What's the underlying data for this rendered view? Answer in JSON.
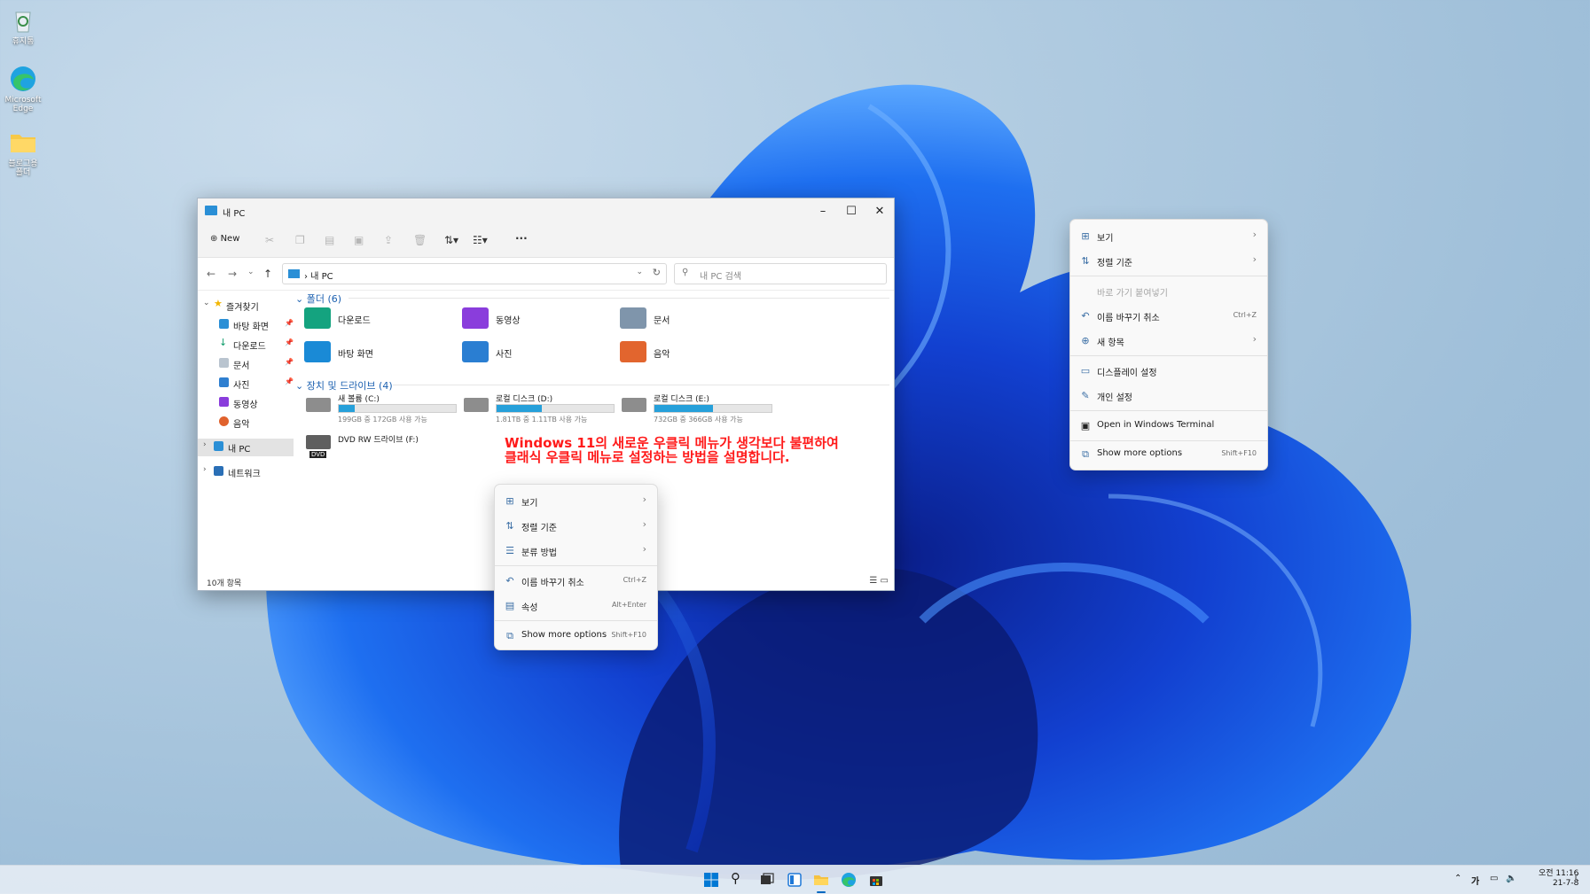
{
  "desktop": {
    "icons": [
      {
        "label": "휴지통",
        "icon": "recycle-bin-icon"
      },
      {
        "label": "Microsoft Edge",
        "icon": "edge-icon"
      },
      {
        "label": "블로그용 폴더",
        "icon": "folder-icon"
      }
    ]
  },
  "explorer": {
    "title": "내 PC",
    "toolbar": {
      "new_label": "New"
    },
    "address": "내 PC",
    "search_placeholder": "내 PC 검색",
    "sidebar": {
      "favorites": "즐겨찾기",
      "items": [
        "바탕 화면",
        "다운로드",
        "문서",
        "사진",
        "동영상",
        "음악"
      ],
      "this_pc": "내 PC",
      "network": "네트워크"
    },
    "folders_header": "폴더 (6)",
    "folders": [
      "다운로드",
      "동영상",
      "문서",
      "바탕 화면",
      "사진",
      "음악"
    ],
    "drives_header": "장치 및 드라이브 (4)",
    "drives": [
      {
        "name": "새 볼륨 (C:)",
        "stats": "199GB 중 172GB 사용 가능",
        "used_fraction": 0.14
      },
      {
        "name": "로컬 디스크 (D:)",
        "stats": "1.81TB 중 1.11TB 사용 가능",
        "used_fraction": 0.39
      },
      {
        "name": "로컬 디스크 (E:)",
        "stats": "732GB 중 366GB 사용 가능",
        "used_fraction": 0.5
      }
    ],
    "dvd": {
      "name": "DVD RW 드라이브 (F:)",
      "badge": "DVD"
    },
    "status": "10개 항목"
  },
  "overlay": {
    "line1": "Windows 11의 새로운 우클릭 메뉴가 생각보다 불편하여",
    "line2": "클래식 우클릭 메뉴로 설정하는 방법을 설명합니다."
  },
  "menu_file": {
    "items": [
      {
        "label": "보기",
        "icon": "grid-icon",
        "arrow": "›"
      },
      {
        "label": "정렬 기준",
        "icon": "sort-icon",
        "arrow": "›"
      },
      {
        "label": "분류 방법",
        "icon": "list-icon",
        "arrow": "›"
      },
      {
        "label": "이름 바꾸기 취소",
        "icon": "undo-icon",
        "shortcut": "Ctrl+Z"
      },
      {
        "label": "속성",
        "icon": "properties-icon",
        "shortcut": "Alt+Enter"
      },
      {
        "label": "Show more options",
        "icon": "more-options-icon",
        "shortcut": "Shift+F10"
      }
    ]
  },
  "menu_desktop": {
    "items": [
      {
        "label": "보기",
        "icon": "grid-icon",
        "arrow": "›"
      },
      {
        "label": "정렬 기준",
        "icon": "sort-icon",
        "arrow": "›"
      },
      {
        "label": "바로 가기 붙여넣기",
        "icon": "",
        "disabled": true
      },
      {
        "label": "이름 바꾸기 취소",
        "icon": "undo-icon",
        "shortcut": "Ctrl+Z"
      },
      {
        "label": "새 항목",
        "icon": "new-item-icon",
        "arrow": "›"
      },
      {
        "label": "디스플레이 설정",
        "icon": "display-icon"
      },
      {
        "label": "개인 설정",
        "icon": "pen-icon"
      },
      {
        "label": "Open in Windows Terminal",
        "icon": "terminal-icon"
      },
      {
        "label": "Show more options",
        "icon": "more-options-icon",
        "shortcut": "Shift+F10"
      }
    ]
  },
  "taskbar": {
    "ime": "가",
    "clock_time": "오전 11:16",
    "clock_date": "21-7-8"
  },
  "colors": {
    "accent": "#0067c0",
    "drive_fill": "#26a0da",
    "overlay_text": "#ff1a1a"
  }
}
